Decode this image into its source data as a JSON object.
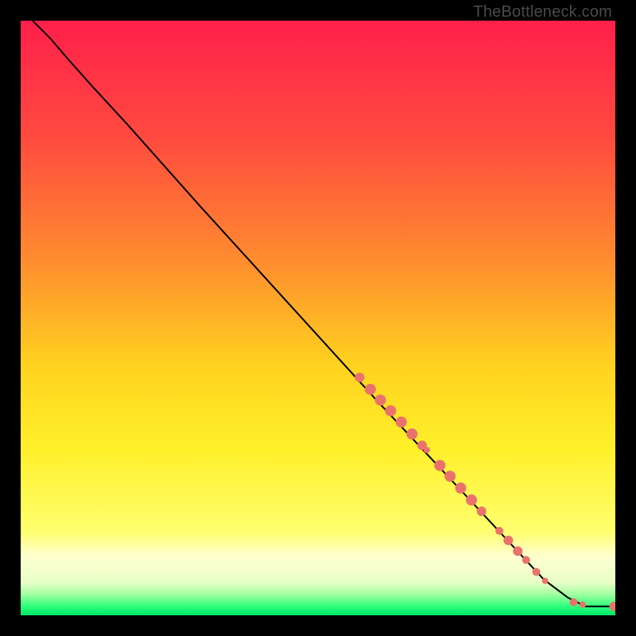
{
  "watermark": "TheBottleneck.com",
  "chart_data": {
    "type": "line",
    "title": "",
    "xlabel": "",
    "ylabel": "",
    "xlim": [
      0,
      100
    ],
    "ylim": [
      0,
      100
    ],
    "grid": false,
    "legend": false,
    "note": "Values are pixel-gradient positions; no axis ticks or numeric labels are rendered in the image, so values are normalized 0–100 estimates read off the plot area.",
    "gradient_stops": [
      {
        "pos": 0.0,
        "color": "#ff1f4b"
      },
      {
        "pos": 0.2,
        "color": "#ff4b3f"
      },
      {
        "pos": 0.4,
        "color": "#ff8b2f"
      },
      {
        "pos": 0.58,
        "color": "#ffd21f"
      },
      {
        "pos": 0.72,
        "color": "#fff02a"
      },
      {
        "pos": 0.86,
        "color": "#ffff70"
      },
      {
        "pos": 0.9,
        "color": "#ffffd0"
      },
      {
        "pos": 0.945,
        "color": "#e8ffc8"
      },
      {
        "pos": 0.965,
        "color": "#9fff9f"
      },
      {
        "pos": 0.985,
        "color": "#2cff7a"
      },
      {
        "pos": 1.0,
        "color": "#00e668"
      }
    ],
    "series": [
      {
        "name": "curve",
        "x": [
          2,
          5,
          8,
          12,
          18,
          30,
          45,
          60,
          75,
          88,
          92,
          95,
          97.5,
          100
        ],
        "y": [
          100,
          97,
          93.5,
          89,
          82.5,
          69,
          52.5,
          36,
          20,
          6,
          3,
          1.5,
          1.5,
          1.5
        ]
      }
    ],
    "scatter_points": [
      {
        "x": 57.0,
        "y": 40.0,
        "r": 6
      },
      {
        "x": 58.8,
        "y": 38.0,
        "r": 7
      },
      {
        "x": 60.5,
        "y": 36.2,
        "r": 7
      },
      {
        "x": 62.2,
        "y": 34.4,
        "r": 7
      },
      {
        "x": 64.0,
        "y": 32.5,
        "r": 7
      },
      {
        "x": 65.8,
        "y": 30.5,
        "r": 7
      },
      {
        "x": 67.5,
        "y": 28.6,
        "r": 6
      },
      {
        "x": 68.3,
        "y": 27.8,
        "r": 4
      },
      {
        "x": 70.5,
        "y": 25.2,
        "r": 7
      },
      {
        "x": 72.2,
        "y": 23.4,
        "r": 7
      },
      {
        "x": 74.0,
        "y": 21.4,
        "r": 7
      },
      {
        "x": 75.8,
        "y": 19.4,
        "r": 7
      },
      {
        "x": 77.5,
        "y": 17.5,
        "r": 6
      },
      {
        "x": 80.5,
        "y": 14.2,
        "r": 5
      },
      {
        "x": 82.0,
        "y": 12.6,
        "r": 6
      },
      {
        "x": 83.6,
        "y": 10.8,
        "r": 6
      },
      {
        "x": 85.0,
        "y": 9.3,
        "r": 5
      },
      {
        "x": 86.7,
        "y": 7.3,
        "r": 5
      },
      {
        "x": 88.2,
        "y": 5.8,
        "r": 4
      },
      {
        "x": 93.0,
        "y": 2.2,
        "r": 5
      },
      {
        "x": 94.5,
        "y": 1.8,
        "r": 4
      },
      {
        "x": 99.8,
        "y": 1.5,
        "r": 6
      }
    ],
    "scatter_color": "#e9736c"
  }
}
